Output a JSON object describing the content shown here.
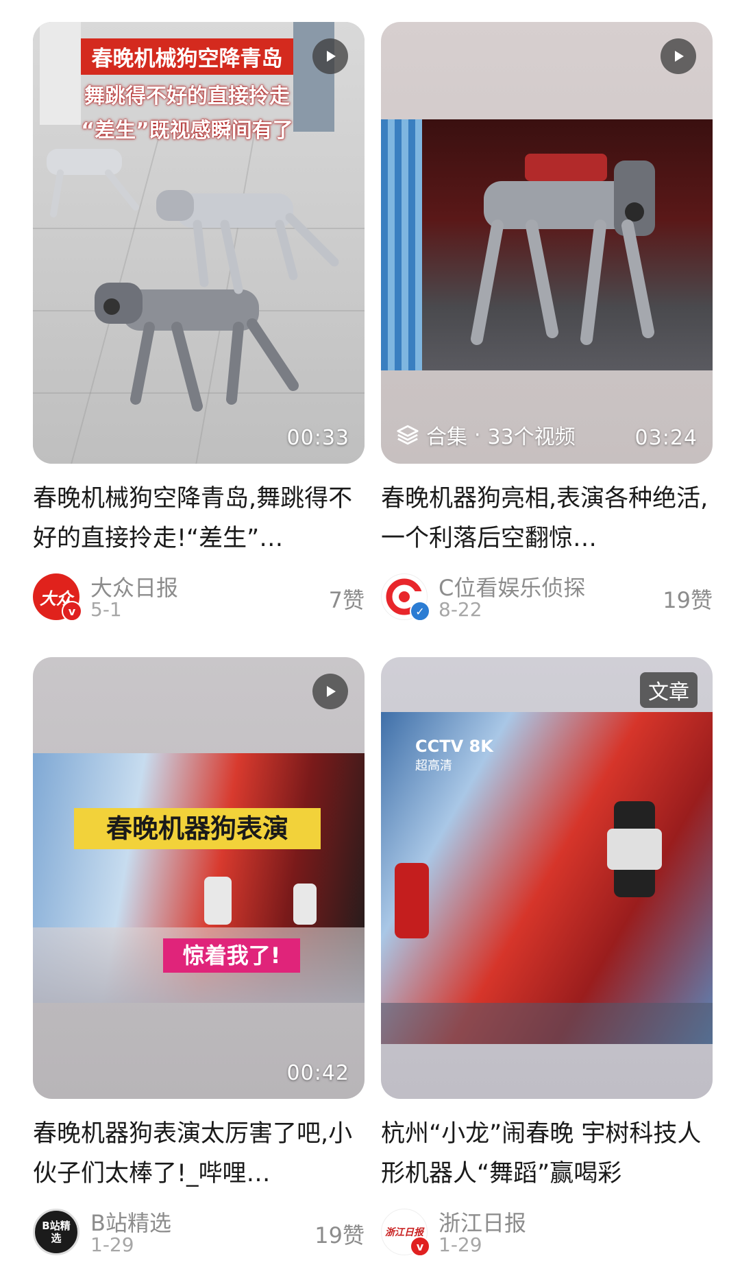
{
  "cards": [
    {
      "title": "春晚机械狗空降青岛,舞跳得不好的直接拎走!“差生”…",
      "source": "大众日报",
      "date": "5-1",
      "likes": "7赞",
      "duration": "00:33",
      "overlay": {
        "line1": "春晚机械狗空降青岛",
        "line2": "舞跳得不好的直接拎走",
        "line3": "“差生”既视感瞬间有了"
      },
      "avatar_text": "大众",
      "verified_color": "#e02020"
    },
    {
      "title": "春晚机器狗亮相,表演各种绝活,一个利落后空翻惊…",
      "source": "C位看娱乐侦探",
      "date": "8-22",
      "likes": "19赞",
      "duration": "03:24",
      "collection_label": "合集",
      "collection_count": "33个视频",
      "verified_color": "#2b7cd3"
    },
    {
      "title": "春晚机器狗表演太厉害了吧,小伙子们太棒了!_哔哩…",
      "source": "B站精选",
      "date": "1-29",
      "likes": "19赞",
      "duration": "00:42",
      "overlay": {
        "banner": "春晚机器狗表演",
        "caption": "惊着我了!"
      },
      "avatar_text": "B站精选"
    },
    {
      "title": "杭州“小龙”闹春晚 宇树科技人形机器人“舞蹈”赢喝彩",
      "source": "浙江日报",
      "date": "1-29",
      "likes": "",
      "badge": "文章",
      "overlay": {
        "logo": "CCTV 8K",
        "logo_sub": "超高清"
      },
      "avatar_text": "浙江日报",
      "verified_color": "#e02020"
    }
  ],
  "icons": {
    "play": "play-icon",
    "collection": "layers-icon",
    "verified": "verified-icon"
  }
}
